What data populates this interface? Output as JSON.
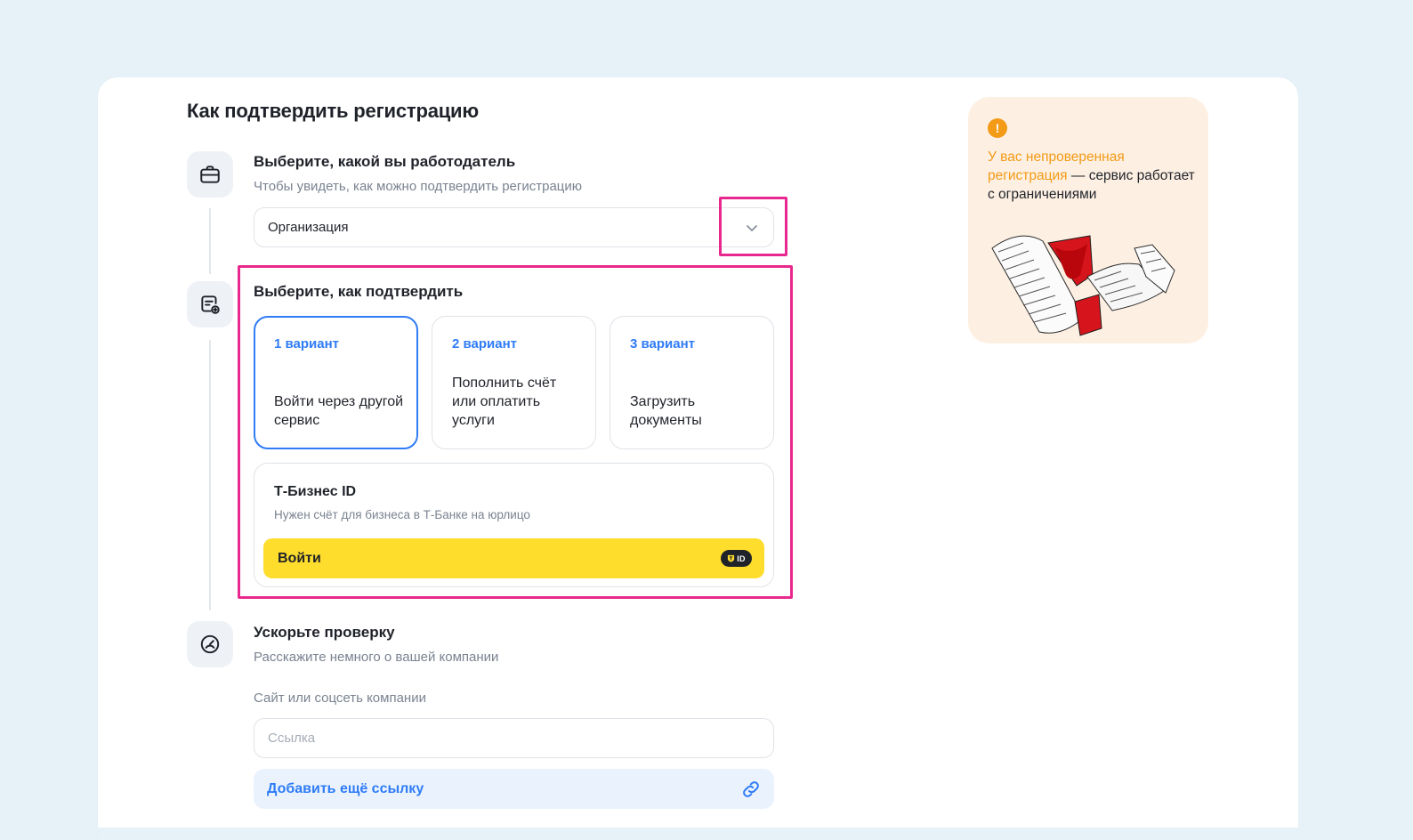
{
  "page": {
    "title": "Как подтвердить регистрацию"
  },
  "step1": {
    "icon": "briefcase-icon",
    "title": "Выберите, какой вы работодатель",
    "subtitle": "Чтобы увидеть, как можно подтвердить регистрацию",
    "select_value": "Организация"
  },
  "step2": {
    "icon": "document-add-icon",
    "title": "Выберите, как подтвердить",
    "variants": [
      {
        "label": "1 вариант",
        "text": "Войти через другой сервис",
        "selected": true
      },
      {
        "label": "2 вариант",
        "text": "Пополнить счёт или оплатить услуги",
        "selected": false
      },
      {
        "label": "3 вариант",
        "text": "Загрузить документы",
        "selected": false
      }
    ],
    "tbiz": {
      "title": "Т-Бизнес ID",
      "subtitle": "Нужен счёт для бизнеса в Т-Банке на юрлицо",
      "button": "Войти",
      "badge": "ID"
    }
  },
  "step3": {
    "icon": "speedometer-icon",
    "title": "Ускорьте проверку",
    "subtitle": "Расскажите немного о вашей компании",
    "field_label": "Сайт или соцсеть компании",
    "field_placeholder": "Ссылка",
    "add_link": "Добавить ещё ссылку"
  },
  "warning": {
    "icon_glyph": "!",
    "accent_text": "У вас непроверенная регистрация",
    "rest_text": " — сервис работает с ограничениями"
  },
  "colors": {
    "accent_blue": "#2f7cf6",
    "highlight_pink": "#e8288f",
    "brand_yellow": "#ffdd2d",
    "warning_orange": "#f39a16",
    "warning_bg": "#fdf0e3",
    "page_bg": "#e6f1f8"
  }
}
